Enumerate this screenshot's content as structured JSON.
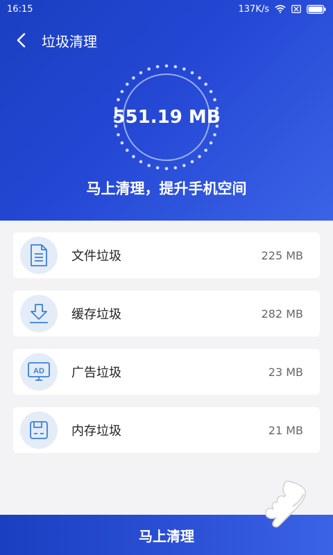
{
  "status_bar": {
    "time": "16:15",
    "speed": "137K/s"
  },
  "header": {
    "title": "垃圾清理"
  },
  "summary": {
    "total_size": "551.19 MB",
    "tagline": "马上清理，提升手机空间"
  },
  "items": [
    {
      "label": "文件垃圾",
      "size": "225 MB",
      "icon": "document-icon"
    },
    {
      "label": "缓存垃圾",
      "size": "282 MB",
      "icon": "download-icon"
    },
    {
      "label": "广告垃圾",
      "size": "23 MB",
      "icon": "ad-icon"
    },
    {
      "label": "内存垃圾",
      "size": "21 MB",
      "icon": "memory-icon"
    }
  ],
  "footer": {
    "button_label": "马上清理"
  },
  "colors": {
    "primary": "#2447d4",
    "icon_bg": "#e4ecf8",
    "icon_stroke": "#3a7fd8"
  }
}
